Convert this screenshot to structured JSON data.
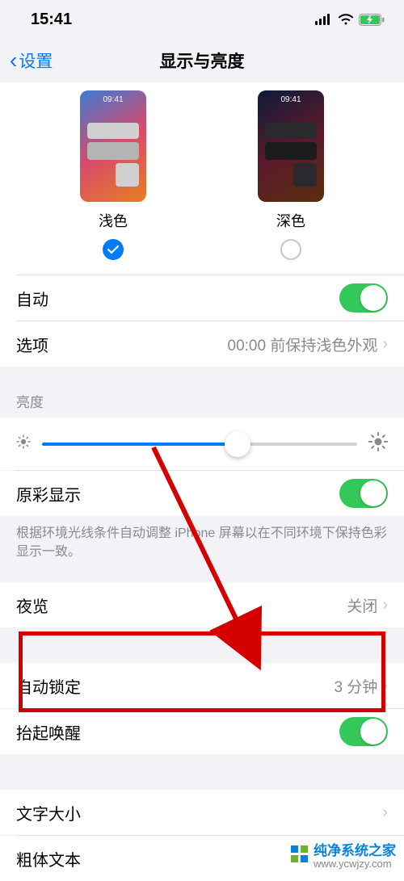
{
  "status_bar": {
    "time": "15:41"
  },
  "nav": {
    "back_label": "设置",
    "title": "显示与亮度"
  },
  "appearance": {
    "preview_time": "09:41",
    "light": {
      "label": "浅色",
      "selected": true
    },
    "dark": {
      "label": "深色",
      "selected": false
    },
    "auto": {
      "label": "自动",
      "on": true
    },
    "options": {
      "label": "选项",
      "detail": "00:00 前保持浅色外观"
    }
  },
  "brightness": {
    "header": "亮度",
    "slider_value": 0.62,
    "true_tone": {
      "label": "原彩显示",
      "on": true
    },
    "footer": "根据环境光线条件自动调整 iPhone 屏幕以在不同环境下保持色彩显示一致。"
  },
  "night_shift": {
    "label": "夜览",
    "detail": "关闭"
  },
  "auto_lock": {
    "label": "自动锁定",
    "detail": "3 分钟"
  },
  "raise_to_wake": {
    "label": "抬起唤醒",
    "on": true
  },
  "text_size": {
    "label": "文字大小"
  },
  "bold_text": {
    "label": "粗体文本",
    "on": false
  },
  "watermark": {
    "title": "纯净系统之家",
    "url": "www.ycwjzy.com"
  }
}
